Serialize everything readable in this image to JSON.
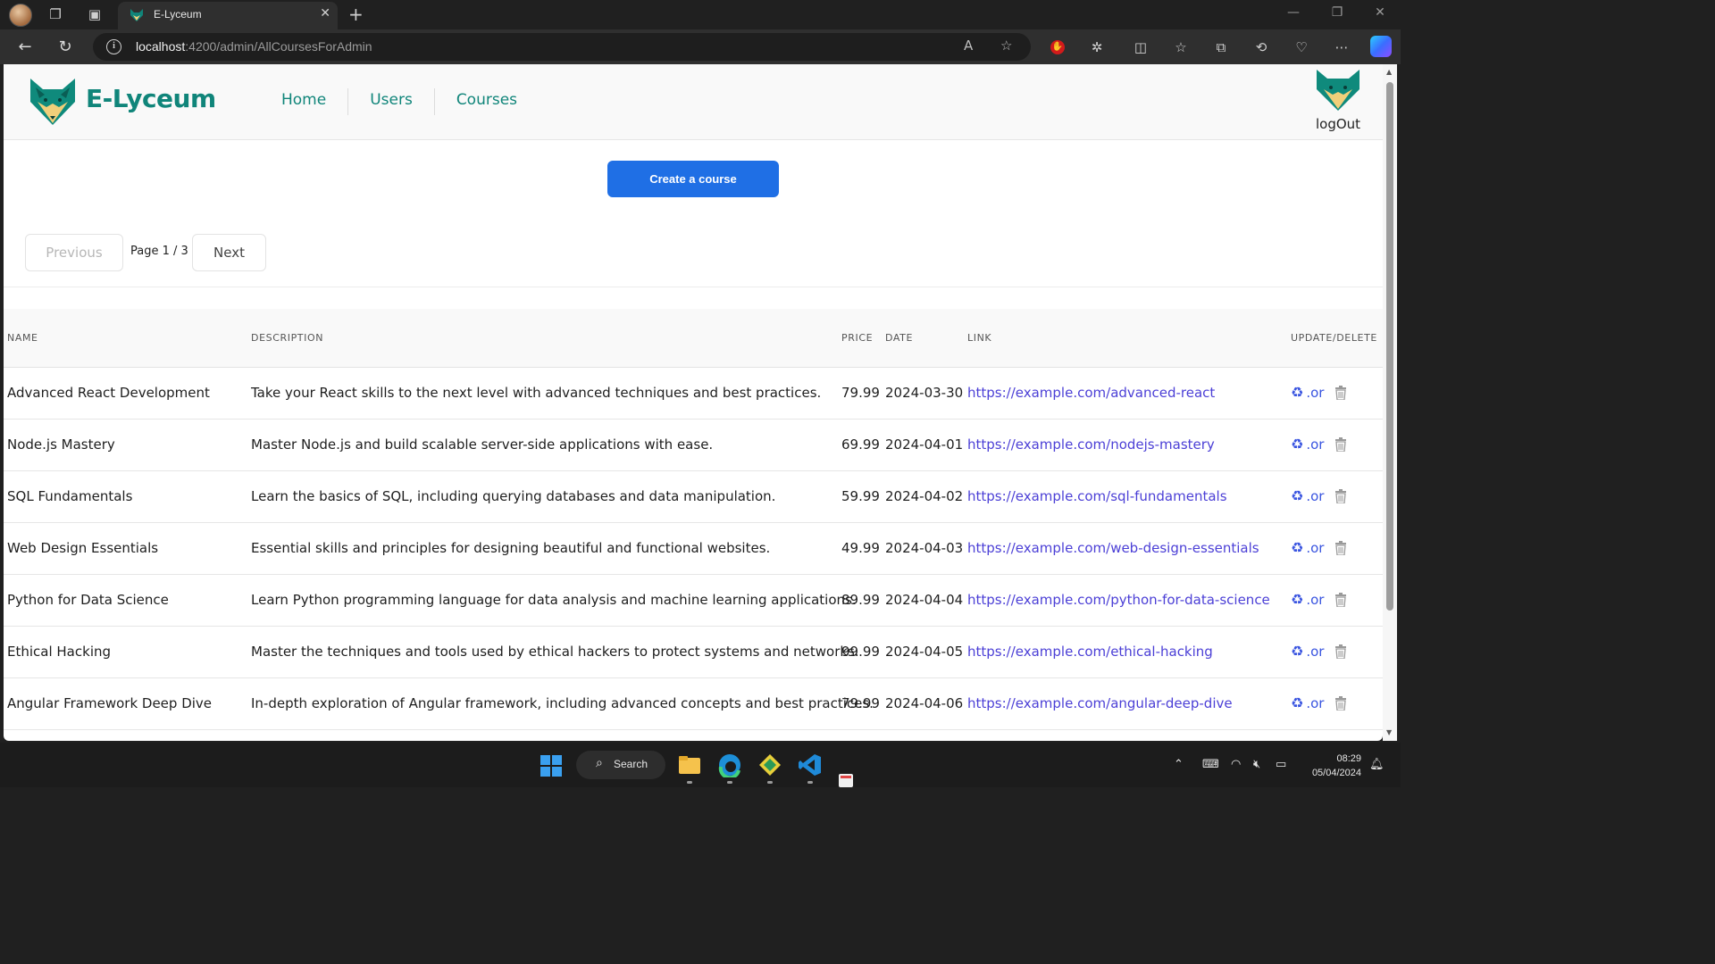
{
  "browser": {
    "tab_title": "E-Lyceum",
    "url_host": "localhost",
    "url_path": ":4200/admin/AllCoursesForAdmin"
  },
  "header": {
    "brand": "E-Lyceum",
    "nav": [
      "Home",
      "Users",
      "Courses"
    ],
    "logout": "logOut"
  },
  "actions": {
    "create_label": "Create a course"
  },
  "pagination": {
    "previous": "Previous",
    "page_label": "Page 1 / 3",
    "next": "Next"
  },
  "table": {
    "headers": {
      "name": "NAME",
      "description": "DESCRIPTION",
      "price": "PRICE",
      "date": "DATE",
      "link": "LINK",
      "update_delete": "UPDATE/DELETE"
    },
    "rows": [
      {
        "name": "Advanced React Development",
        "description": "Take your React skills to the next level with advanced techniques and best practices.",
        "price": "79.99",
        "date": "2024-03-30",
        "link": "https://example.com/advanced-react"
      },
      {
        "name": "Node.js Mastery",
        "description": "Master Node.js and build scalable server-side applications with ease.",
        "price": "69.99",
        "date": "2024-04-01",
        "link": "https://example.com/nodejs-mastery"
      },
      {
        "name": "SQL Fundamentals",
        "description": "Learn the basics of SQL, including querying databases and data manipulation.",
        "price": "59.99",
        "date": "2024-04-02",
        "link": "https://example.com/sql-fundamentals"
      },
      {
        "name": "Web Design Essentials",
        "description": "Essential skills and principles for designing beautiful and functional websites.",
        "price": "49.99",
        "date": "2024-04-03",
        "link": "https://example.com/web-design-essentials"
      },
      {
        "name": "Python for Data Science",
        "description": "Learn Python programming language for data analysis and machine learning applications.",
        "price": "89.99",
        "date": "2024-04-04",
        "link": "https://example.com/python-for-data-science"
      },
      {
        "name": "Ethical Hacking",
        "description": "Master the techniques and tools used by ethical hackers to protect systems and networks.",
        "price": "99.99",
        "date": "2024-04-05",
        "link": "https://example.com/ethical-hacking"
      },
      {
        "name": "Angular Framework Deep Dive",
        "description": "In-depth exploration of Angular framework, including advanced concepts and best practices.",
        "price": "79.99",
        "date": "2024-04-06",
        "link": "https://example.com/angular-deep-dive"
      }
    ],
    "or_label": ".or",
    "update_icon": "recycle-icon",
    "delete_icon": "trash-icon"
  },
  "taskbar": {
    "search_label": "Search",
    "time": "08:29",
    "date": "05/04/2024"
  },
  "colors": {
    "brand_teal": "#10857a",
    "primary_blue": "#1f6fe5",
    "link_purple": "#4b3fd6"
  }
}
